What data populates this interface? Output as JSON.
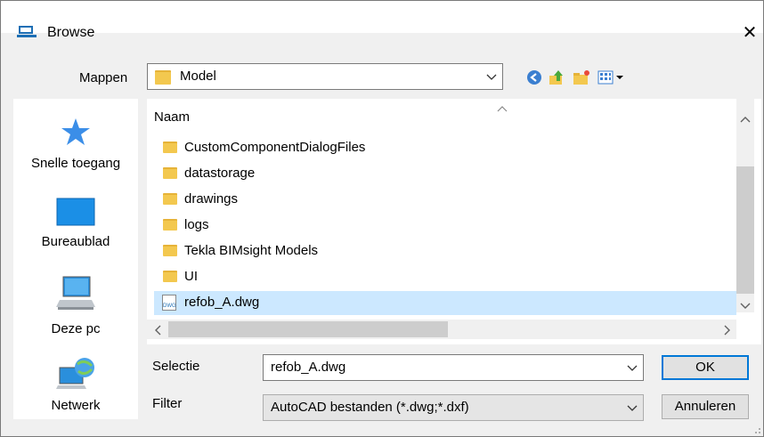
{
  "window": {
    "title": "Browse",
    "close_glyph": "✕"
  },
  "mappen": {
    "label": "Mappen",
    "value": "Model"
  },
  "sidebar": {
    "items": [
      {
        "label": "Snelle toegang",
        "icon": "star-icon"
      },
      {
        "label": "Bureaublad",
        "icon": "desktop-icon"
      },
      {
        "label": "Deze pc",
        "icon": "computer-icon"
      },
      {
        "label": "Netwerk",
        "icon": "network-icon"
      }
    ]
  },
  "filelist": {
    "header": "Naam",
    "rows": [
      {
        "name": "CustomComponentDialogFiles",
        "type": "folder"
      },
      {
        "name": "datastorage",
        "type": "folder"
      },
      {
        "name": "drawings",
        "type": "folder"
      },
      {
        "name": "logs",
        "type": "folder"
      },
      {
        "name": "Tekla BIMsight Models",
        "type": "folder"
      },
      {
        "name": "UI",
        "type": "folder"
      },
      {
        "name": "refob_A.dwg",
        "type": "dwg",
        "selected": true
      }
    ],
    "dwg_icon_text": "DWG"
  },
  "selectie": {
    "label": "Selectie",
    "value": "refob_A.dwg"
  },
  "filter": {
    "label": "Filter",
    "value": "AutoCAD bestanden (*.dwg;*.dxf)"
  },
  "buttons": {
    "ok": "OK",
    "cancel": "Annuleren"
  },
  "colors": {
    "selection": "#cce8ff",
    "folder": "#f3c84f",
    "accent": "#0078d7"
  }
}
